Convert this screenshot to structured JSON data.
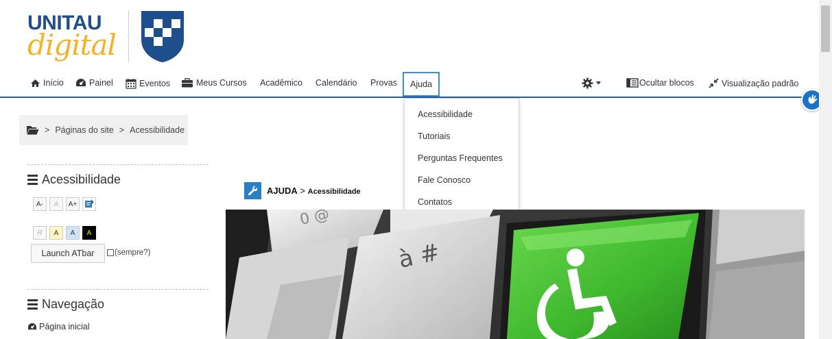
{
  "logo": {
    "line1": "UNITAU",
    "line2": "digital"
  },
  "nav": {
    "inicio": "Início",
    "painel": "Painel",
    "eventos": "Eventos",
    "meus_cursos": "Meus Cursos",
    "academico": "Acadêmico",
    "calendario": "Calendário",
    "provas": "Provas",
    "ajuda": "Ajuda",
    "ocultar_blocos": "Ocultar blocos",
    "visualizacao": "Visualização padrão"
  },
  "dropdown": {
    "items": [
      "Acessibilidade",
      "Tutoriais",
      "Perguntas Frequentes",
      "Fale Conosco",
      "Contatos"
    ]
  },
  "breadcrumb": {
    "sep": ">",
    "level1": "Páginas do site",
    "level2": "Acessibilidade"
  },
  "blocks": {
    "acessibilidade_title": "Acessibilidade",
    "font_buttons": [
      "A-",
      "A",
      "A+"
    ],
    "color_buttons": [
      "R",
      "A",
      "A",
      "A"
    ],
    "launch": "Launch ATbar",
    "sempre": "(sempre?)",
    "navegacao_title": "Navegação",
    "pagina_inicial": "Página inicial"
  },
  "content": {
    "head_main": "AJUDA",
    "head_sep": ">",
    "head_sub": "Acessibilidade"
  },
  "hero_keys": {
    "key1": "à #",
    "key2": "0 @"
  },
  "colors": {
    "brand_blue": "#1f4e8c",
    "brand_yellow": "#f0b429",
    "nav_underline": "#1f5da8",
    "highlight": "#3a8dd8",
    "key_green": "#4cc23a"
  }
}
